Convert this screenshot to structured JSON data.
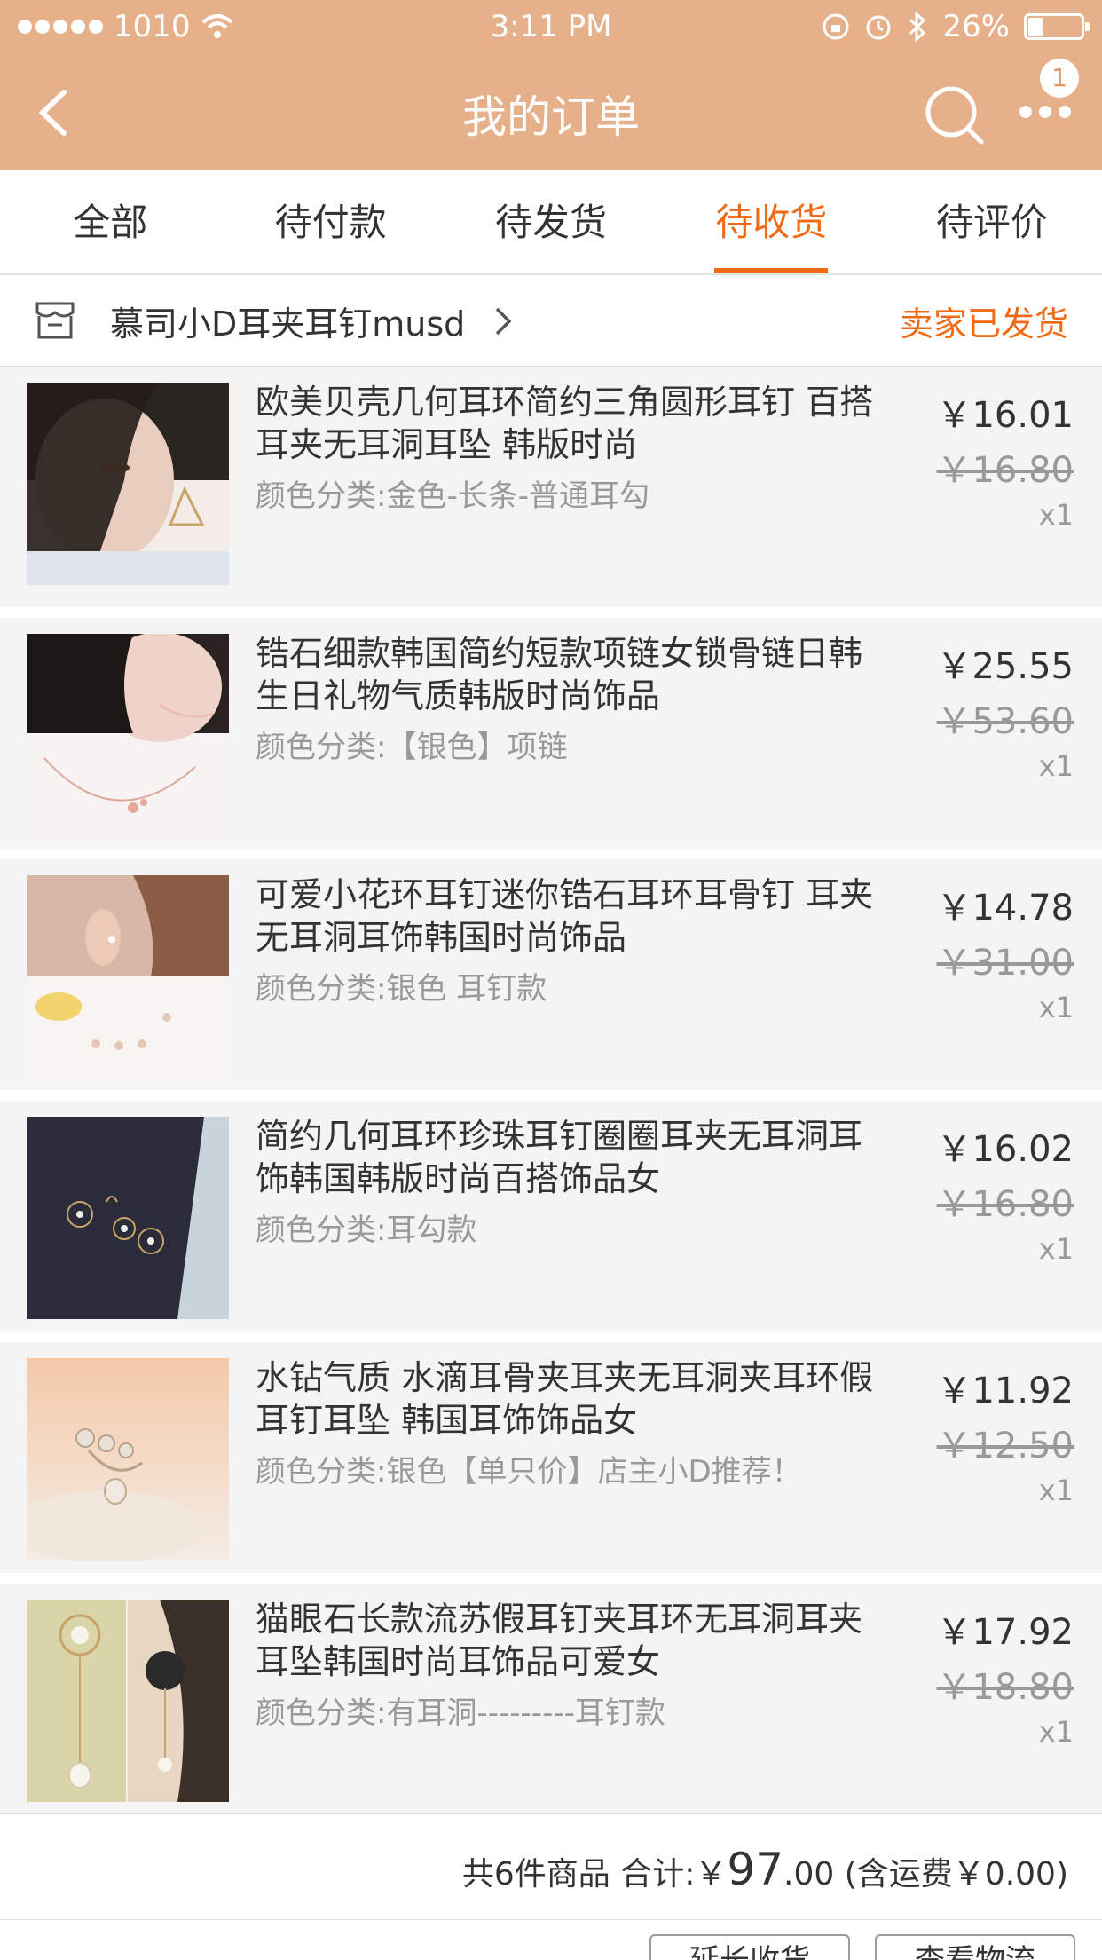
{
  "status_bar": {
    "carrier": "1010",
    "time": "3:11 PM",
    "battery": "26%"
  },
  "nav": {
    "title": "我的订单",
    "badge_count": "1"
  },
  "tabs": [
    {
      "label": "全部"
    },
    {
      "label": "待付款"
    },
    {
      "label": "待发货"
    },
    {
      "label": "待收货",
      "active": true
    },
    {
      "label": "待评价"
    }
  ],
  "shop": {
    "name": "慕司小D耳夹耳钉musd",
    "status": "卖家已发货"
  },
  "items": [
    {
      "title": "欧美贝壳几何耳环简约三角圆形耳钉 百搭耳夹无耳洞耳坠 韩版时尚",
      "spec": "颜色分类:金色-长条-普通耳勾",
      "price": "￥16.01",
      "original_price": "￥16.80",
      "qty": "x1"
    },
    {
      "title": "锆石细款韩国简约短款项链女锁骨链日韩生日礼物气质韩版时尚饰品",
      "spec": "颜色分类:【银色】项链",
      "price": "￥25.55",
      "original_price": "￥53.60",
      "qty": "x1"
    },
    {
      "title": "可爱小花环耳钉迷你锆石耳环耳骨钉 耳夹无耳洞耳饰韩国时尚饰品",
      "spec": "颜色分类:银色 耳钉款",
      "price": "￥14.78",
      "original_price": "￥31.00",
      "qty": "x1"
    },
    {
      "title": "简约几何耳环珍珠耳钉圈圈耳夹无耳洞耳饰韩国韩版时尚百搭饰品女",
      "spec": "颜色分类:耳勾款",
      "price": "￥16.02",
      "original_price": "￥16.80",
      "qty": "x1"
    },
    {
      "title": "水钻气质 水滴耳骨夹耳夹无耳洞夹耳环假耳钉耳坠 韩国耳饰饰品女",
      "spec": "颜色分类:银色【单只价】店主小D推荐！",
      "price": "￥11.92",
      "original_price": "￥12.50",
      "qty": "x1"
    },
    {
      "title": "猫眼石长款流苏假耳钉夹耳环无耳洞耳夹耳坠韩国时尚耳饰品可爱女",
      "spec": "颜色分类:有耳洞---------耳钉款",
      "price": "￥17.92",
      "original_price": "￥18.80",
      "qty": "x1"
    }
  ],
  "summary": {
    "count_text": "共6件商品 合计:",
    "currency": "￥",
    "total_int": "97",
    "total_dec": ".00",
    "shipping_text": "(含运费￥0.00)"
  },
  "actions": {
    "extend_label": "延长收货",
    "logistics_label": "查看物流"
  },
  "colors": {
    "header_bg": "#e6b08a",
    "accent": "#f06a16"
  }
}
